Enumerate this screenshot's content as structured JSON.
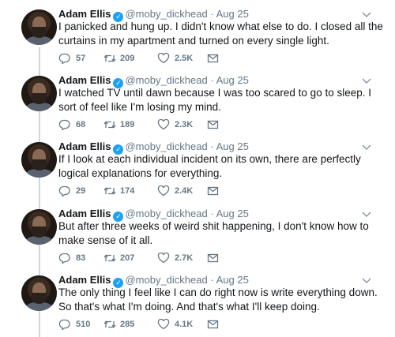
{
  "tweets": [
    {
      "name": "Adam Ellis",
      "handle": "@moby_dickhead",
      "separator": "·",
      "date": "Aug 25",
      "text": "I panicked and hung up. I didn't know what else to do. I closed all the curtains in my apartment and turned on every single light.",
      "replies": "57",
      "retweets": "209",
      "likes": "2.5K"
    },
    {
      "name": "Adam Ellis",
      "handle": "@moby_dickhead",
      "separator": "·",
      "date": "Aug 25",
      "text": "I watched TV until dawn because I was too scared to go to sleep. I sort of feel like I'm losing my mind.",
      "replies": "68",
      "retweets": "189",
      "likes": "2.3K"
    },
    {
      "name": "Adam Ellis",
      "handle": "@moby_dickhead",
      "separator": "·",
      "date": "Aug 25",
      "text": "If I look at each individual incident on its own, there are perfectly logical explanations for everything.",
      "replies": "29",
      "retweets": "174",
      "likes": "2.4K"
    },
    {
      "name": "Adam Ellis",
      "handle": "@moby_dickhead",
      "separator": "·",
      "date": "Aug 25",
      "text": "But after three weeks of weird shit happening, I don't know how to make sense of it all.",
      "replies": "83",
      "retweets": "207",
      "likes": "2.7K"
    },
    {
      "name": "Adam Ellis",
      "handle": "@moby_dickhead",
      "separator": "·",
      "date": "Aug 25",
      "text": "The only thing I feel like I can do right now is write everything down. So that's what I'm doing. And that's what I'll keep doing.",
      "replies": "510",
      "retweets": "285",
      "likes": "4.1K"
    }
  ],
  "icons": {
    "verified": "verified-badge-icon",
    "reply": "reply-icon",
    "retweet": "retweet-icon",
    "like": "heart-icon",
    "message": "envelope-icon",
    "more": "chevron-down-icon"
  },
  "colors": {
    "text": "#14171a",
    "secondary": "#657786",
    "verified": "#1da1f2",
    "thread_line": "#ccd6dd"
  }
}
